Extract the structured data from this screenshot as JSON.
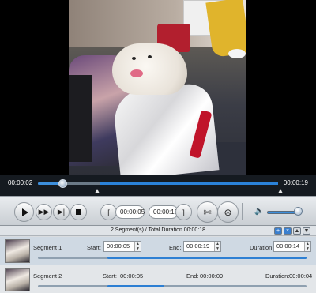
{
  "timeline": {
    "current_time": "00:00:02",
    "total_time": "00:00:19",
    "playhead_fraction": 0.11,
    "selection_start_fraction": 0.26,
    "selection_end_fraction": 1.0
  },
  "controls": {
    "start_field": "00:00:05",
    "end_field": "00:00:19",
    "volume_fraction": 0.85
  },
  "segments_header": {
    "summary": "2 Segment(s) / Total Duration 00:00:18"
  },
  "segments": [
    {
      "name": "Segment 1",
      "start_label": "Start:",
      "start": "00:00:05",
      "end_label": "End:",
      "end": "00:00:19",
      "duration_label": "Duration:",
      "duration": "00:00:14",
      "bar_start_fraction": 0.26,
      "bar_end_fraction": 1.0,
      "selected": true
    },
    {
      "name": "Segment 2",
      "start_label": "Start:",
      "start": "00:00:05",
      "end_label": "End:",
      "end": "00:00:09",
      "duration_label": "Duration:",
      "duration": "00:00:04",
      "bar_start_fraction": 0.26,
      "bar_end_fraction": 0.47,
      "selected": false
    }
  ],
  "icons": {
    "play": "play-icon",
    "fast_forward": "fast-forward-icon",
    "next_frame": "next-frame-icon",
    "stop": "stop-icon",
    "set_start": "set-start-icon",
    "set_end": "set-end-icon",
    "new_clip": "new-clip-icon",
    "merge": "merge-icon",
    "volume": "speaker-icon"
  },
  "colors": {
    "accent": "#2b82d9",
    "timeline_bg": "#151a20"
  }
}
